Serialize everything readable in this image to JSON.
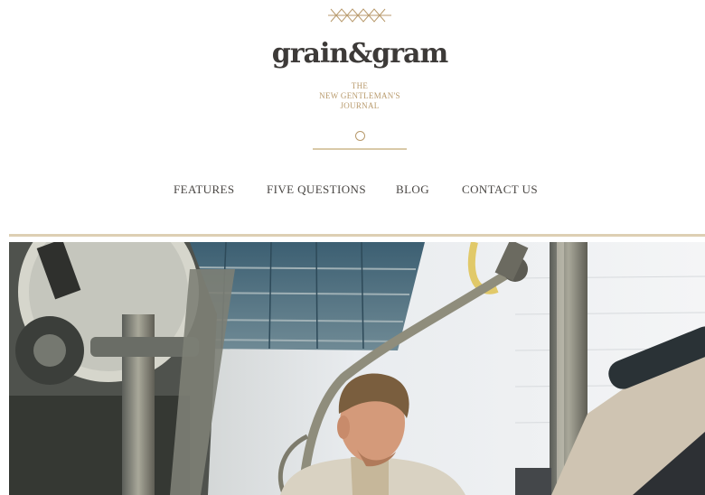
{
  "site": {
    "logo_text": "grain&gram",
    "tagline": [
      "THE",
      "NEW GENTLEMAN'S",
      "JOURNAL"
    ]
  },
  "nav": {
    "items": [
      {
        "label": "FEATURES"
      },
      {
        "label": "FIVE QUESTIONS"
      },
      {
        "label": "BLOG"
      },
      {
        "label": "CONTACT US"
      }
    ]
  },
  "colors": {
    "accent_gold": "#b89a6c",
    "rule": "#ddcfb3",
    "logo": "#3d3a38",
    "nav_text": "#4a4744"
  },
  "icons": {
    "ornament": "diamond-chain-ornament-icon",
    "divider": "circle-divider-icon"
  },
  "hero": {
    "image": "photo of a man working among workshop machinery"
  }
}
